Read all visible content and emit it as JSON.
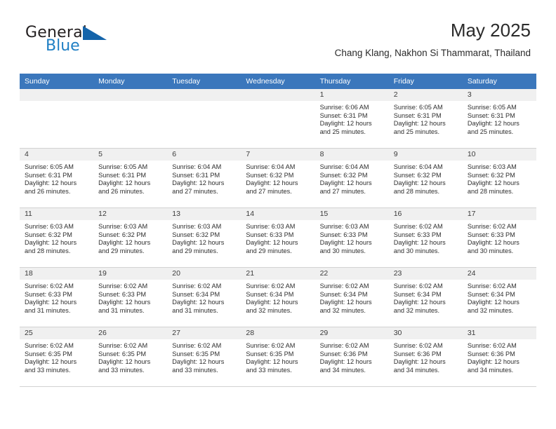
{
  "brand": {
    "name_part1": "General",
    "name_part2": "Blue",
    "mark": "triangle-logo"
  },
  "header": {
    "month_title": "May 2025",
    "location": "Chang Klang, Nakhon Si Thammarat, Thailand",
    "header_color": "#3b77bc"
  },
  "calendar": {
    "weekday_headers": [
      "Sunday",
      "Monday",
      "Tuesday",
      "Wednesday",
      "Thursday",
      "Friday",
      "Saturday"
    ],
    "weeks": [
      [
        {
          "day": "",
          "blank": true
        },
        {
          "day": "",
          "blank": true
        },
        {
          "day": "",
          "blank": true
        },
        {
          "day": "",
          "blank": true
        },
        {
          "day": "1",
          "sunrise": "Sunrise: 6:06 AM",
          "sunset": "Sunset: 6:31 PM",
          "daylight_line1": "Daylight: 12 hours",
          "daylight_line2": "and 25 minutes."
        },
        {
          "day": "2",
          "sunrise": "Sunrise: 6:05 AM",
          "sunset": "Sunset: 6:31 PM",
          "daylight_line1": "Daylight: 12 hours",
          "daylight_line2": "and 25 minutes."
        },
        {
          "day": "3",
          "sunrise": "Sunrise: 6:05 AM",
          "sunset": "Sunset: 6:31 PM",
          "daylight_line1": "Daylight: 12 hours",
          "daylight_line2": "and 25 minutes."
        }
      ],
      [
        {
          "day": "4",
          "sunrise": "Sunrise: 6:05 AM",
          "sunset": "Sunset: 6:31 PM",
          "daylight_line1": "Daylight: 12 hours",
          "daylight_line2": "and 26 minutes."
        },
        {
          "day": "5",
          "sunrise": "Sunrise: 6:05 AM",
          "sunset": "Sunset: 6:31 PM",
          "daylight_line1": "Daylight: 12 hours",
          "daylight_line2": "and 26 minutes."
        },
        {
          "day": "6",
          "sunrise": "Sunrise: 6:04 AM",
          "sunset": "Sunset: 6:31 PM",
          "daylight_line1": "Daylight: 12 hours",
          "daylight_line2": "and 27 minutes."
        },
        {
          "day": "7",
          "sunrise": "Sunrise: 6:04 AM",
          "sunset": "Sunset: 6:32 PM",
          "daylight_line1": "Daylight: 12 hours",
          "daylight_line2": "and 27 minutes."
        },
        {
          "day": "8",
          "sunrise": "Sunrise: 6:04 AM",
          "sunset": "Sunset: 6:32 PM",
          "daylight_line1": "Daylight: 12 hours",
          "daylight_line2": "and 27 minutes."
        },
        {
          "day": "9",
          "sunrise": "Sunrise: 6:04 AM",
          "sunset": "Sunset: 6:32 PM",
          "daylight_line1": "Daylight: 12 hours",
          "daylight_line2": "and 28 minutes."
        },
        {
          "day": "10",
          "sunrise": "Sunrise: 6:03 AM",
          "sunset": "Sunset: 6:32 PM",
          "daylight_line1": "Daylight: 12 hours",
          "daylight_line2": "and 28 minutes."
        }
      ],
      [
        {
          "day": "11",
          "sunrise": "Sunrise: 6:03 AM",
          "sunset": "Sunset: 6:32 PM",
          "daylight_line1": "Daylight: 12 hours",
          "daylight_line2": "and 28 minutes."
        },
        {
          "day": "12",
          "sunrise": "Sunrise: 6:03 AM",
          "sunset": "Sunset: 6:32 PM",
          "daylight_line1": "Daylight: 12 hours",
          "daylight_line2": "and 29 minutes."
        },
        {
          "day": "13",
          "sunrise": "Sunrise: 6:03 AM",
          "sunset": "Sunset: 6:32 PM",
          "daylight_line1": "Daylight: 12 hours",
          "daylight_line2": "and 29 minutes."
        },
        {
          "day": "14",
          "sunrise": "Sunrise: 6:03 AM",
          "sunset": "Sunset: 6:33 PM",
          "daylight_line1": "Daylight: 12 hours",
          "daylight_line2": "and 29 minutes."
        },
        {
          "day": "15",
          "sunrise": "Sunrise: 6:03 AM",
          "sunset": "Sunset: 6:33 PM",
          "daylight_line1": "Daylight: 12 hours",
          "daylight_line2": "and 30 minutes."
        },
        {
          "day": "16",
          "sunrise": "Sunrise: 6:02 AM",
          "sunset": "Sunset: 6:33 PM",
          "daylight_line1": "Daylight: 12 hours",
          "daylight_line2": "and 30 minutes."
        },
        {
          "day": "17",
          "sunrise": "Sunrise: 6:02 AM",
          "sunset": "Sunset: 6:33 PM",
          "daylight_line1": "Daylight: 12 hours",
          "daylight_line2": "and 30 minutes."
        }
      ],
      [
        {
          "day": "18",
          "sunrise": "Sunrise: 6:02 AM",
          "sunset": "Sunset: 6:33 PM",
          "daylight_line1": "Daylight: 12 hours",
          "daylight_line2": "and 31 minutes."
        },
        {
          "day": "19",
          "sunrise": "Sunrise: 6:02 AM",
          "sunset": "Sunset: 6:33 PM",
          "daylight_line1": "Daylight: 12 hours",
          "daylight_line2": "and 31 minutes."
        },
        {
          "day": "20",
          "sunrise": "Sunrise: 6:02 AM",
          "sunset": "Sunset: 6:34 PM",
          "daylight_line1": "Daylight: 12 hours",
          "daylight_line2": "and 31 minutes."
        },
        {
          "day": "21",
          "sunrise": "Sunrise: 6:02 AM",
          "sunset": "Sunset: 6:34 PM",
          "daylight_line1": "Daylight: 12 hours",
          "daylight_line2": "and 32 minutes."
        },
        {
          "day": "22",
          "sunrise": "Sunrise: 6:02 AM",
          "sunset": "Sunset: 6:34 PM",
          "daylight_line1": "Daylight: 12 hours",
          "daylight_line2": "and 32 minutes."
        },
        {
          "day": "23",
          "sunrise": "Sunrise: 6:02 AM",
          "sunset": "Sunset: 6:34 PM",
          "daylight_line1": "Daylight: 12 hours",
          "daylight_line2": "and 32 minutes."
        },
        {
          "day": "24",
          "sunrise": "Sunrise: 6:02 AM",
          "sunset": "Sunset: 6:34 PM",
          "daylight_line1": "Daylight: 12 hours",
          "daylight_line2": "and 32 minutes."
        }
      ],
      [
        {
          "day": "25",
          "sunrise": "Sunrise: 6:02 AM",
          "sunset": "Sunset: 6:35 PM",
          "daylight_line1": "Daylight: 12 hours",
          "daylight_line2": "and 33 minutes."
        },
        {
          "day": "26",
          "sunrise": "Sunrise: 6:02 AM",
          "sunset": "Sunset: 6:35 PM",
          "daylight_line1": "Daylight: 12 hours",
          "daylight_line2": "and 33 minutes."
        },
        {
          "day": "27",
          "sunrise": "Sunrise: 6:02 AM",
          "sunset": "Sunset: 6:35 PM",
          "daylight_line1": "Daylight: 12 hours",
          "daylight_line2": "and 33 minutes."
        },
        {
          "day": "28",
          "sunrise": "Sunrise: 6:02 AM",
          "sunset": "Sunset: 6:35 PM",
          "daylight_line1": "Daylight: 12 hours",
          "daylight_line2": "and 33 minutes."
        },
        {
          "day": "29",
          "sunrise": "Sunrise: 6:02 AM",
          "sunset": "Sunset: 6:36 PM",
          "daylight_line1": "Daylight: 12 hours",
          "daylight_line2": "and 34 minutes."
        },
        {
          "day": "30",
          "sunrise": "Sunrise: 6:02 AM",
          "sunset": "Sunset: 6:36 PM",
          "daylight_line1": "Daylight: 12 hours",
          "daylight_line2": "and 34 minutes."
        },
        {
          "day": "31",
          "sunrise": "Sunrise: 6:02 AM",
          "sunset": "Sunset: 6:36 PM",
          "daylight_line1": "Daylight: 12 hours",
          "daylight_line2": "and 34 minutes."
        }
      ]
    ]
  }
}
